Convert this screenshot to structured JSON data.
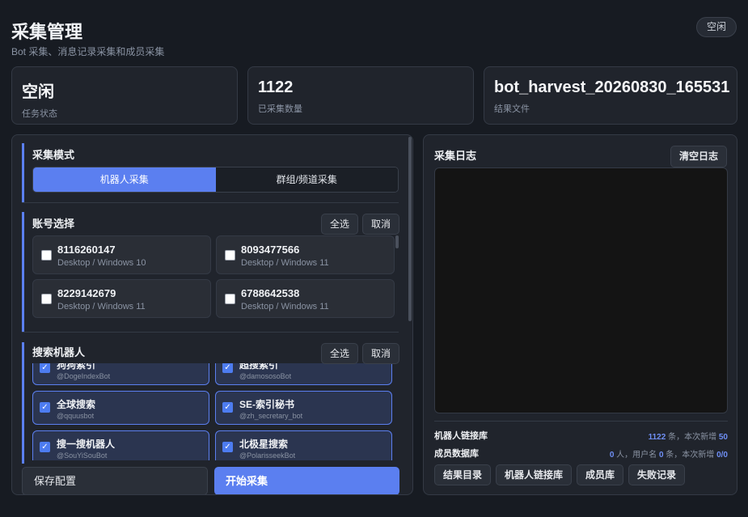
{
  "header": {
    "title": "采集管理",
    "subtitle": "Bot 采集、消息记录采集和成员采集",
    "status": "空闲"
  },
  "stats": [
    {
      "value": "空闲",
      "label": "任务状态"
    },
    {
      "value": "1122",
      "label": "已采集数量"
    },
    {
      "value": "bot_harvest_20260830_165531",
      "label": "结果文件"
    }
  ],
  "mode": {
    "title": "采集模式",
    "options": [
      "机器人采集",
      "群组/频道采集"
    ],
    "selected": "机器人采集"
  },
  "accounts": {
    "title": "账号选择",
    "select_all": "全选",
    "cancel": "取消",
    "items": [
      {
        "id": "8116260147",
        "os": "Desktop / Windows 10",
        "checked": false
      },
      {
        "id": "8093477566",
        "os": "Desktop / Windows 11",
        "checked": false
      },
      {
        "id": "8229142679",
        "os": "Desktop / Windows 11",
        "checked": false
      },
      {
        "id": "6788642538",
        "os": "Desktop / Windows 11",
        "checked": false
      }
    ]
  },
  "bots": {
    "title": "搜索机器人",
    "select_all": "全选",
    "cancel": "取消",
    "items": [
      {
        "name": "狗狗索引",
        "username": "@DogeIndexBot",
        "checked": true
      },
      {
        "name": "超搜索引",
        "username": "@damososoBot",
        "checked": true
      },
      {
        "name": "全球搜索",
        "username": "@qquusbot",
        "checked": true
      },
      {
        "name": "SE-索引秘书",
        "username": "@zh_secretary_bot",
        "checked": true
      },
      {
        "name": "搜一搜机器人",
        "username": "@SouYiSouBot",
        "checked": true
      },
      {
        "name": "北极星搜索",
        "username": "@PolarisseekBot",
        "checked": true
      }
    ]
  },
  "actions": {
    "save": "保存配置",
    "start": "开始采集"
  },
  "log": {
    "title": "采集日志",
    "clear": "清空日志",
    "content": ""
  },
  "db": {
    "bot_label": "机器人链接库",
    "bot_count": "1122",
    "bot_unit": " 条，本次新增 ",
    "bot_new": "50",
    "member_label": "成员数据库",
    "member_count": "0",
    "member_unit1": " 人，用户名 ",
    "member_usernames": "0",
    "member_unit2": " 条，本次新增 ",
    "member_new": "0/0"
  },
  "links": [
    "结果目录",
    "机器人链接库",
    "成员库",
    "失败记录"
  ]
}
